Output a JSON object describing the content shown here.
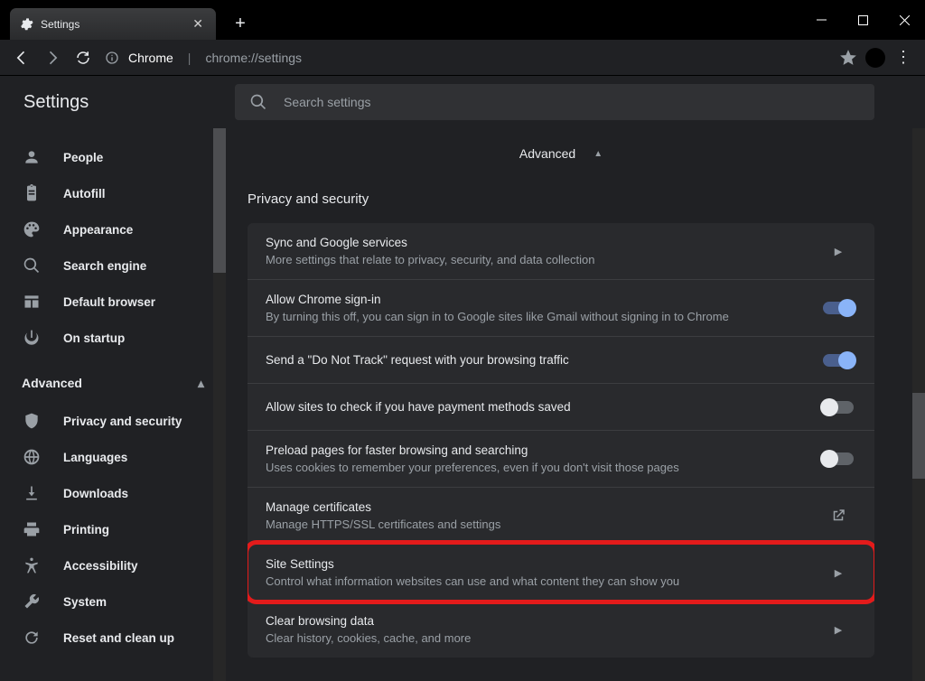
{
  "window": {
    "tab_title": "Settings"
  },
  "addressbar": {
    "host": "Chrome",
    "path": "chrome://settings"
  },
  "app": {
    "title": "Settings",
    "search_placeholder": "Search settings"
  },
  "sidebar": {
    "basic": [
      {
        "icon": "person",
        "label": "People"
      },
      {
        "icon": "clipboard",
        "label": "Autofill"
      },
      {
        "icon": "palette",
        "label": "Appearance"
      },
      {
        "icon": "search",
        "label": "Search engine"
      },
      {
        "icon": "browser",
        "label": "Default browser"
      },
      {
        "icon": "power",
        "label": "On startup"
      }
    ],
    "advanced_label": "Advanced",
    "advanced": [
      {
        "icon": "shield",
        "label": "Privacy and security"
      },
      {
        "icon": "globe",
        "label": "Languages"
      },
      {
        "icon": "download",
        "label": "Downloads"
      },
      {
        "icon": "print",
        "label": "Printing"
      },
      {
        "icon": "accessibility",
        "label": "Accessibility"
      },
      {
        "icon": "wrench",
        "label": "System"
      },
      {
        "icon": "restore",
        "label": "Reset and clean up"
      }
    ]
  },
  "main": {
    "advanced_toggle": "Advanced",
    "section_title": "Privacy and security",
    "rows": [
      {
        "title": "Sync and Google services",
        "sub": "More settings that relate to privacy, security, and data collection",
        "control": "arrow"
      },
      {
        "title": "Allow Chrome sign-in",
        "sub": "By turning this off, you can sign in to Google sites like Gmail without signing in to Chrome",
        "control": "toggle-on"
      },
      {
        "title": "Send a \"Do Not Track\" request with your browsing traffic",
        "sub": "",
        "control": "toggle-on"
      },
      {
        "title": "Allow sites to check if you have payment methods saved",
        "sub": "",
        "control": "toggle-off"
      },
      {
        "title": "Preload pages for faster browsing and searching",
        "sub": "Uses cookies to remember your preferences, even if you don't visit those pages",
        "control": "toggle-off"
      },
      {
        "title": "Manage certificates",
        "sub": "Manage HTTPS/SSL certificates and settings",
        "control": "launch"
      },
      {
        "title": "Site Settings",
        "sub": "Control what information websites can use and what content they can show you",
        "control": "arrow",
        "highlight": true
      },
      {
        "title": "Clear browsing data",
        "sub": "Clear history, cookies, cache, and more",
        "control": "arrow"
      }
    ]
  }
}
